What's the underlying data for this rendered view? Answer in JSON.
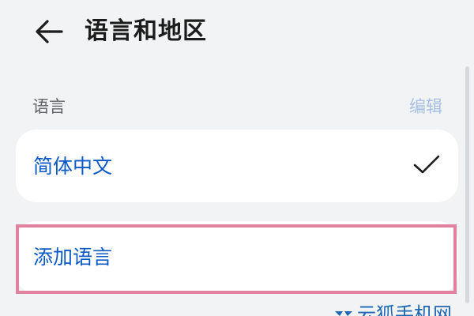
{
  "header": {
    "back_icon": "arrow-left-icon",
    "title": "语言和地区"
  },
  "language_section": {
    "label": "语言",
    "edit_label": "编辑"
  },
  "languages": [
    {
      "name": "简体中文",
      "selected": true,
      "selected_icon": "checkmark-icon"
    }
  ],
  "add_language": {
    "label": "添加语言",
    "highlight_color": "#e0819f"
  },
  "watermark": {
    "text": "云狐手机网",
    "logo_icon": "watermark-logo-icon"
  },
  "colors": {
    "background": "#f1f3f5",
    "card": "#ffffff",
    "accent": "#0a59c7",
    "edit_disabled": "#a6bfe3",
    "title": "#1c1c1c",
    "section_label": "#5f6166"
  }
}
